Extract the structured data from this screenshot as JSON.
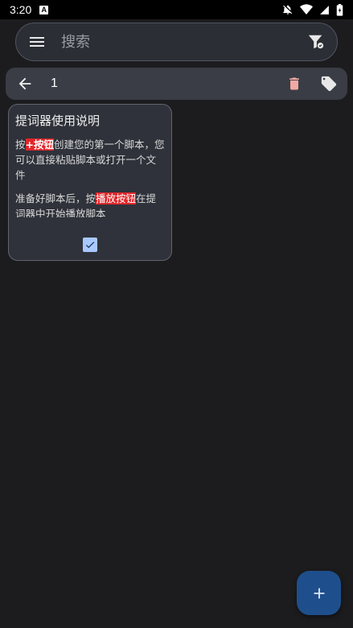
{
  "status_bar": {
    "time": "3:20",
    "notification_letter": "A"
  },
  "search": {
    "placeholder": "搜索",
    "value": ""
  },
  "selection": {
    "count": "1"
  },
  "colors": {
    "accent_red": "#e0262a",
    "delete_icon": "#f0a9a3",
    "checkbox": "#a8c8ff",
    "fab": "#1e4f8c"
  },
  "notes": [
    {
      "title": "提词器使用说明",
      "para1_pre": "按",
      "para1_hl": "+按钮",
      "para1_post": "创建您的第一个脚本，您可以直接粘贴脚本或打开一个文件",
      "para2_pre": "准备好脚本后，按",
      "para2_hl": "播放按钮",
      "para2_post": "在提词器中开始播放脚本",
      "selected": true
    }
  ]
}
